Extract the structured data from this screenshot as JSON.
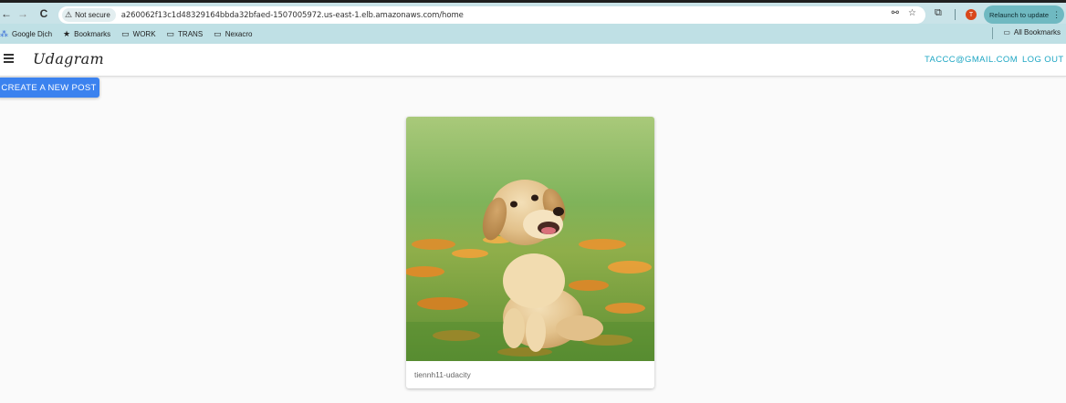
{
  "browser": {
    "nav": {
      "back": "←",
      "forward": "→",
      "reload": "C"
    },
    "security_chip": "Not secure",
    "url": "a260062f13c1d48329164bbda32bfaed-1507005972.us-east-1.elb.amazonaws.com/home",
    "profile_initial": "T",
    "relaunch_label": "Relaunch to update",
    "icons": [
      "password-key-icon",
      "star-icon",
      "extensions-icon",
      "more-icon"
    ]
  },
  "bookmarks": {
    "items": [
      {
        "label": "Google Dịch",
        "icon": "translate-icon"
      },
      {
        "label": "Bookmarks",
        "icon": "star-icon"
      },
      {
        "label": "WORK",
        "icon": "folder-icon"
      },
      {
        "label": "TRANS",
        "icon": "folder-icon"
      },
      {
        "label": "Nexacro",
        "icon": "folder-icon"
      }
    ],
    "all_label": "All Bookmarks"
  },
  "app": {
    "brand": "Udagram",
    "user_email": "TACCC@GMAIL.COM",
    "logout_label": "LOG OUT",
    "create_post_label": "CREATE A NEW POST"
  },
  "posts": [
    {
      "caption": "tiennh11-udacity",
      "image": "golden-retriever-puppy-photo"
    }
  ],
  "colors": {
    "accent_link": "#1fa7c4",
    "primary_button": "#3b82ef",
    "chrome_bar": "#c9e3e8"
  }
}
